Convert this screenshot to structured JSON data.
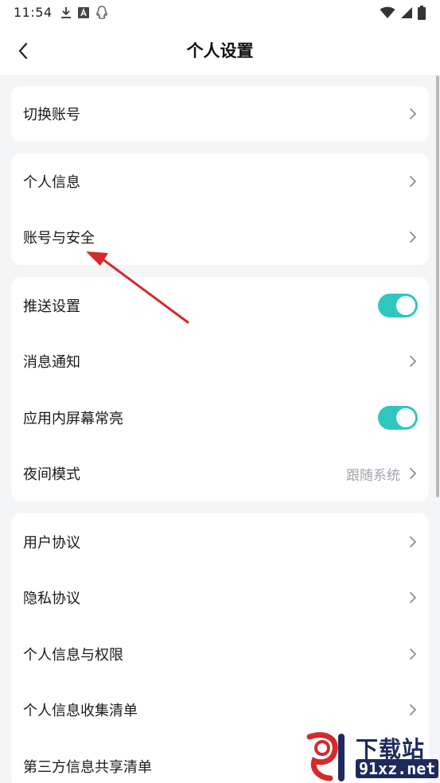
{
  "status_bar": {
    "time": "11:54",
    "left_icons": [
      "download-icon",
      "a-box-icon",
      "qq-icon"
    ],
    "right_icons": [
      "wifi-icon",
      "signal-icon",
      "battery-icon"
    ]
  },
  "header": {
    "back_icon": "chevron-left-icon",
    "title": "个人设置"
  },
  "cards": [
    {
      "rows": [
        {
          "label": "切换账号",
          "control": "chevron"
        }
      ]
    },
    {
      "rows": [
        {
          "label": "个人信息",
          "control": "chevron"
        },
        {
          "label": "账号与安全",
          "control": "chevron"
        }
      ]
    },
    {
      "rows": [
        {
          "label": "推送设置",
          "control": "toggle",
          "on": true
        },
        {
          "label": "消息通知",
          "control": "chevron"
        },
        {
          "label": "应用内屏幕常亮",
          "control": "toggle",
          "on": true
        },
        {
          "label": "夜间模式",
          "control": "chevron",
          "value": "跟随系统"
        }
      ]
    },
    {
      "rows": [
        {
          "label": "用户协议",
          "control": "chevron"
        },
        {
          "label": "隐私协议",
          "control": "chevron"
        },
        {
          "label": "个人信息与权限",
          "control": "chevron"
        },
        {
          "label": "个人信息收集清单",
          "control": "chevron"
        },
        {
          "label": "第三方信息共享清单",
          "control": "chevron"
        }
      ]
    }
  ],
  "colors": {
    "toggle_on": "#2ec7c0",
    "annotation_arrow": "#d42a2a",
    "watermark": "#1e2a5c",
    "watermark_accent": "#d42a2a"
  },
  "watermark": {
    "title": "下载站",
    "domain": "91xz.net",
    "logo_text": "91"
  }
}
